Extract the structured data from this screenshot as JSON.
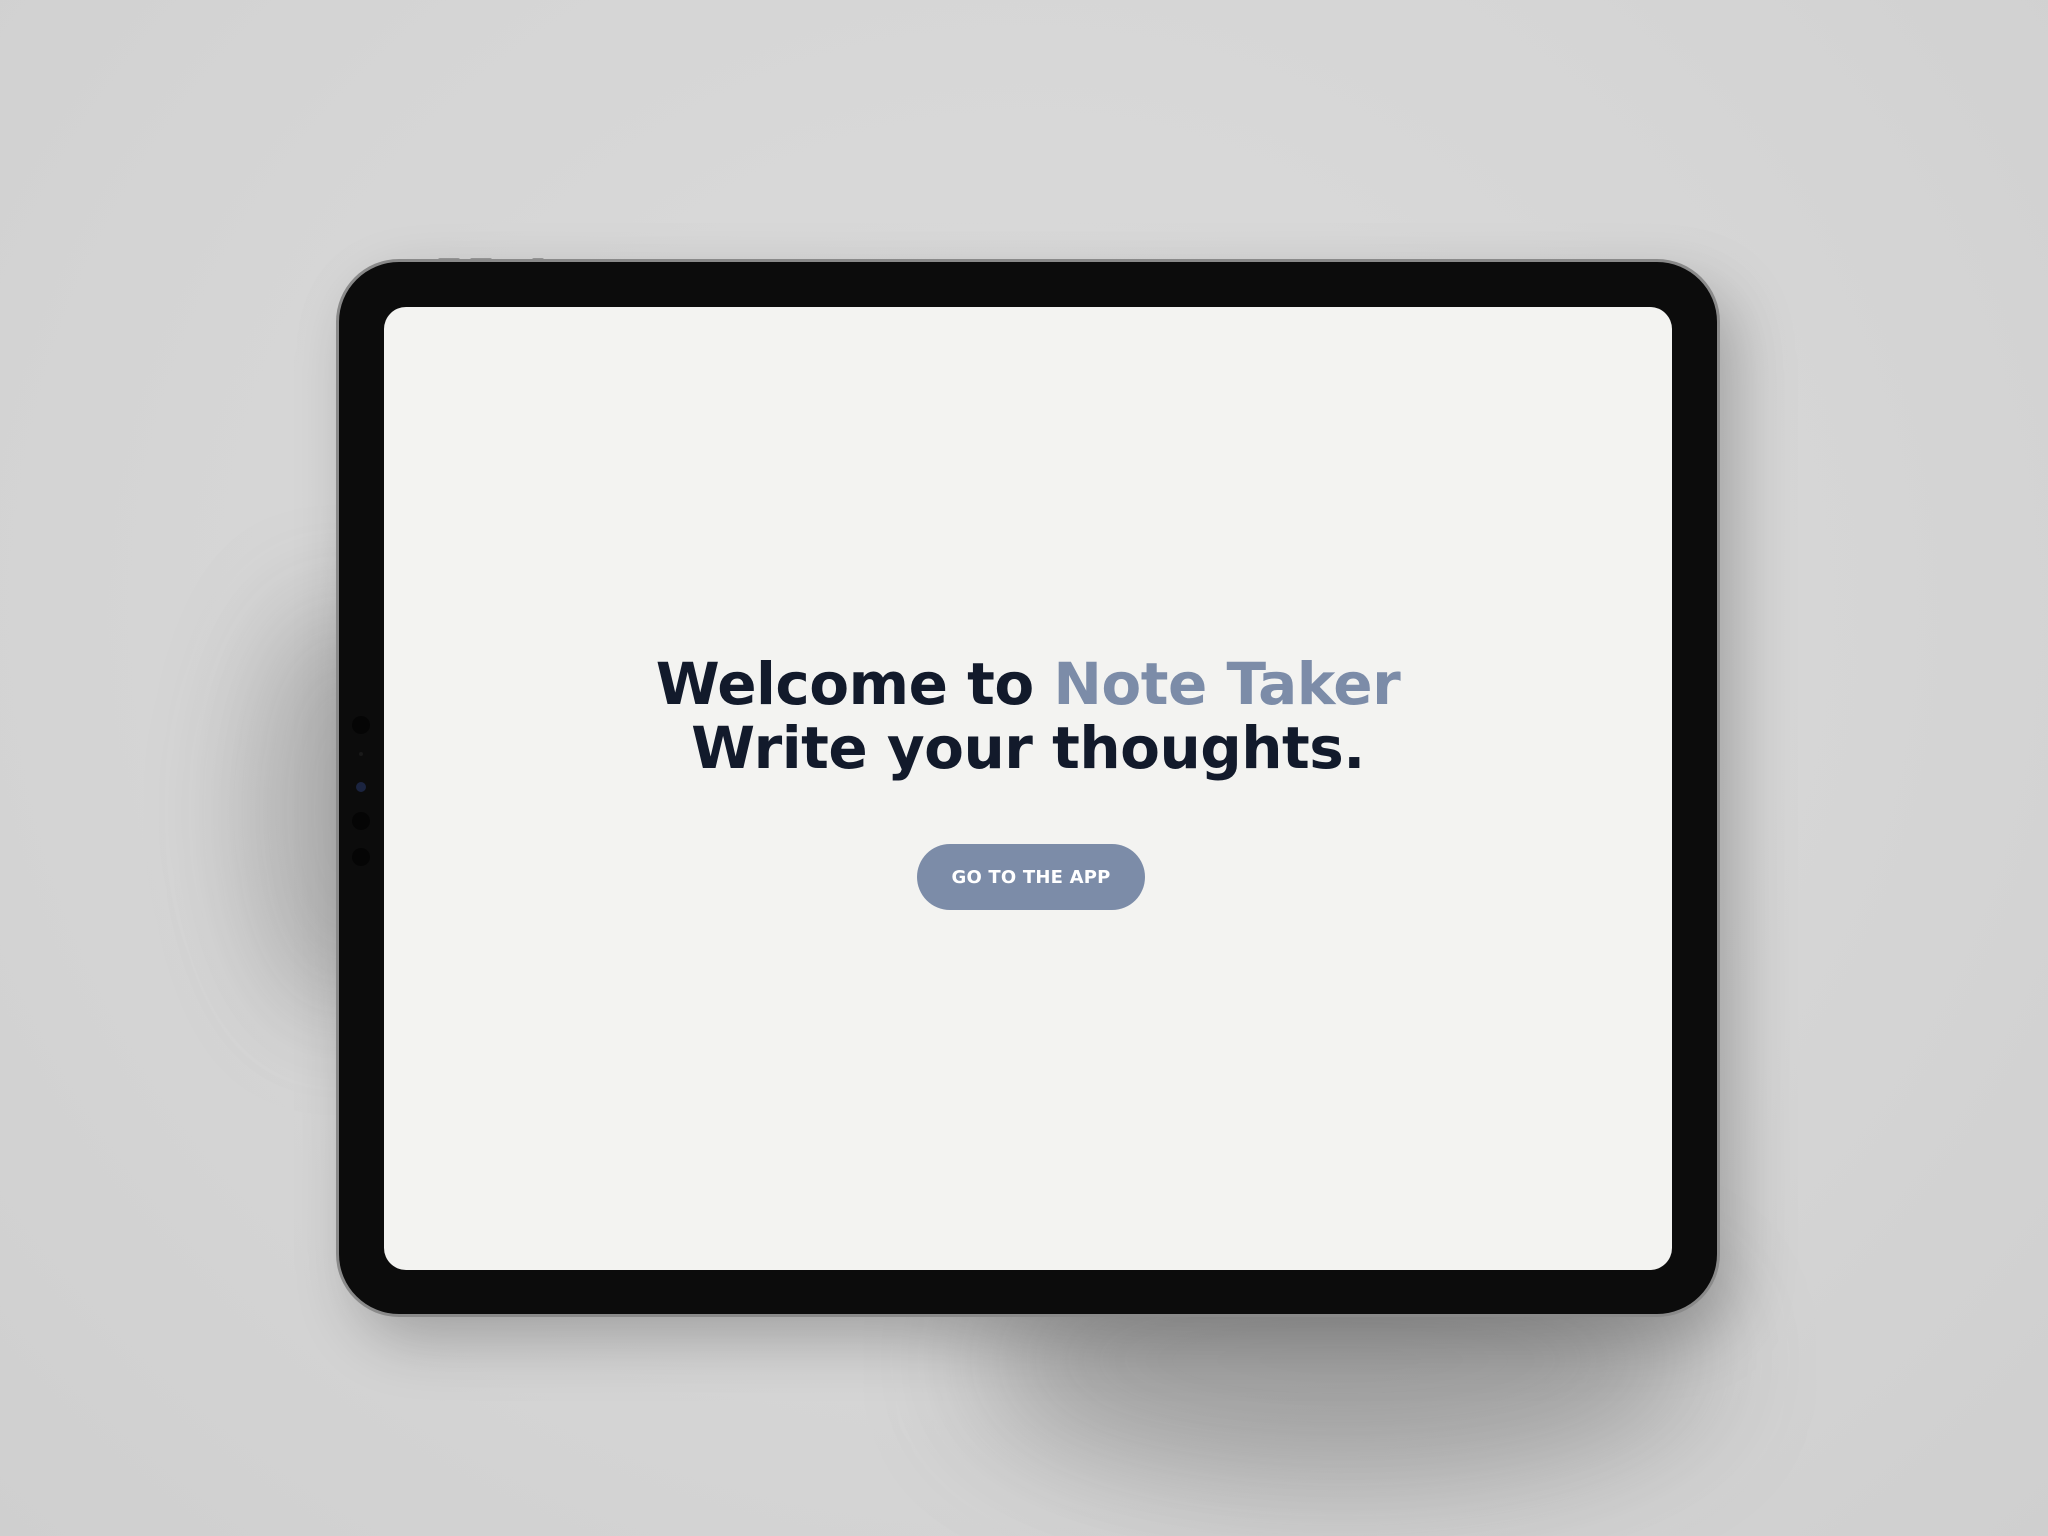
{
  "hero": {
    "line1_prefix": "Welcome to ",
    "app_name": "Note Taker",
    "line2": "Write your thoughts."
  },
  "cta": {
    "label": "GO TO THE APP"
  },
  "colors": {
    "accent": "#7c8ca8",
    "heading": "#121a2b",
    "screen_bg": "#f3f3f1",
    "bezel": "#0c0c0c"
  }
}
